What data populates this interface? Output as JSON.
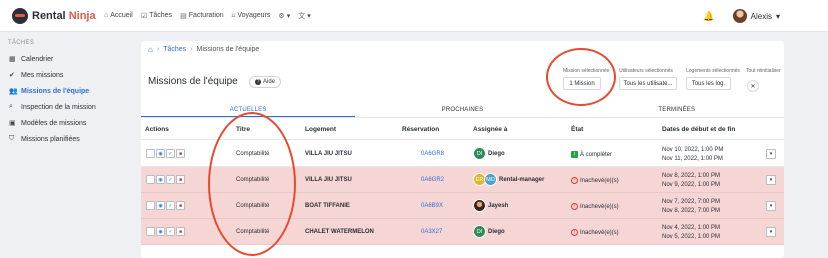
{
  "app": {
    "logo_main": "Rental",
    "logo_accent": "Ninja"
  },
  "topnav": {
    "items": [
      {
        "icon": "home-icon",
        "label": "Accueil"
      },
      {
        "icon": "checkbox-icon",
        "label": "Tâches"
      },
      {
        "icon": "invoice-icon",
        "label": "Facturation"
      },
      {
        "icon": "people-icon",
        "label": "Voyageurs"
      }
    ],
    "user_name": "Alexis"
  },
  "sidebar": {
    "heading": "TÂCHES",
    "items": [
      {
        "label": "Calendrier",
        "icon": "calendar-icon",
        "active": false
      },
      {
        "label": "Mes missions",
        "icon": "check-icon",
        "active": false
      },
      {
        "label": "Missions de l'équipe",
        "icon": "team-icon",
        "active": true
      },
      {
        "label": "Inspection de la mission",
        "icon": "search-icon",
        "active": false
      },
      {
        "label": "Modèles de missions",
        "icon": "template-icon",
        "active": false
      },
      {
        "label": "Missions planifiées",
        "icon": "shield-icon",
        "active": false
      }
    ]
  },
  "breadcrumb": {
    "link": "Tâches",
    "current": "Missions de l'équipe"
  },
  "page": {
    "title": "Missions de l'équipe",
    "help_label": "Aide"
  },
  "filters": {
    "missions_label": "Mission sélectionnée",
    "missions_value": "1 Mission",
    "users_label": "Utilisateurs sélectionnés",
    "users_value": "Tous les utilisate...",
    "properties_label": "Logements sélectionnés",
    "properties_value": "Tous les log.",
    "reset_label": "Tout réinitialiser"
  },
  "tabs": [
    {
      "label": "ACTUELLES",
      "active": true
    },
    {
      "label": "PROCHAINES",
      "active": false
    },
    {
      "label": "TERMINÉES",
      "active": false
    }
  ],
  "table": {
    "headers": {
      "actions": "Actions",
      "title": "Titre",
      "property": "Logement",
      "reservation": "Réservation",
      "assigned": "Assignée à",
      "status": "État",
      "dates": "Dates de début et de fin"
    },
    "rows": [
      {
        "title": "Comptabilité",
        "property": "VILLA JIU JITSU",
        "reservation": "0A6GR8",
        "assignees": [
          {
            "initials": "DI",
            "color": "#2e8b57"
          }
        ],
        "assignee_name": "Diego",
        "status": "À compléter",
        "status_type": "pending",
        "start": "Nov 10, 2022, 1:00 PM",
        "end": "Nov 11, 2022, 1:00 PM"
      },
      {
        "title": "Comptabilité",
        "property": "VILLA JIU JITSU",
        "reservation": "0A6GR2",
        "assignees": [
          {
            "initials": "ER",
            "color": "#e0b52a"
          },
          {
            "initials": "MO",
            "color": "#4aa3c8"
          }
        ],
        "assignee_name": "Rental-manager",
        "status": "Inachevé(e)(s)",
        "status_type": "incomplete",
        "start": "Nov 8, 2022, 1:00 PM",
        "end": "Nov 9, 2022, 1:00 PM"
      },
      {
        "title": "Comptabilité",
        "property": "BOAT TIFFANIE",
        "reservation": "0A6B9X",
        "assignees": [
          {
            "initials": "",
            "color": "#5a3b2a"
          }
        ],
        "assignee_name": "Jayesh",
        "status": "Inachevé(e)(s)",
        "status_type": "incomplete",
        "start": "Nov 7, 2022, 7:00 PM",
        "end": "Nov 8, 2022, 7:00 PM"
      },
      {
        "title": "Comptabilité",
        "property": "CHALET WATERMELON",
        "reservation": "0A3X27",
        "assignees": [
          {
            "initials": "DI",
            "color": "#2e8b57"
          }
        ],
        "assignee_name": "Diego",
        "status": "Inachevé(e)(s)",
        "status_type": "incomplete",
        "start": "Nov 4, 2022, 1:00 PM",
        "end": "Nov 5, 2022, 1:00 PM"
      }
    ]
  },
  "colors": {
    "accent": "#2f6fd6",
    "incomplete_row": "#f6d5d5",
    "annotation": "#e8492f"
  }
}
